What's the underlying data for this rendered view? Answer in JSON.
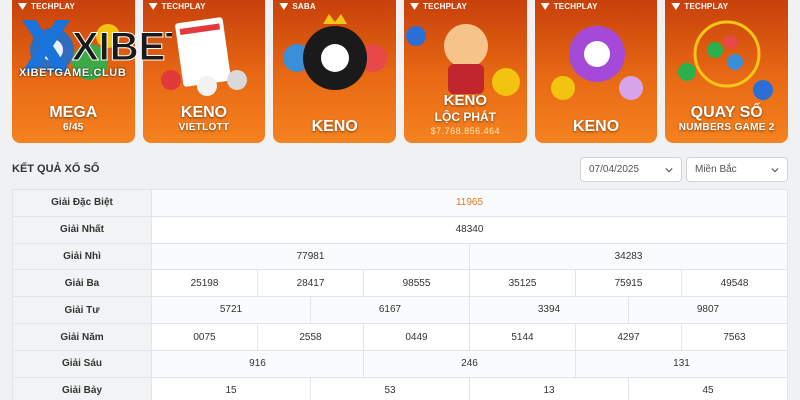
{
  "brand": {
    "name": "XIBET",
    "url": "XIBETGAME.CLUB"
  },
  "cards": [
    {
      "provider": "TECHPLAY",
      "title": "MEGA",
      "subtitle": "6/45"
    },
    {
      "provider": "TECHPLAY",
      "title": "KENO",
      "subtitle": "VIETLOTT"
    },
    {
      "provider": "SABA",
      "title": "KENO"
    },
    {
      "provider": "TECHPLAY",
      "title": "KENO",
      "subtitle": "LỘC PHÁT",
      "jackpot": "$7.768.856.464"
    },
    {
      "provider": "TECHPLAY",
      "title": "KENO"
    },
    {
      "provider": "TECHPLAY",
      "title": "QUAY SỐ",
      "subtitle": "NUMBERS GAME 2"
    }
  ],
  "results": {
    "title": "KẾT QUẢ XỔ SỐ",
    "date": "07/04/2025",
    "region": "Miền Bắc",
    "rows": [
      {
        "label": "Giải Đặc Biệt",
        "values": [
          "11965"
        ]
      },
      {
        "label": "Giải Nhất",
        "values": [
          "48340"
        ]
      },
      {
        "label": "Giải Nhì",
        "values": [
          "77981",
          "34283"
        ]
      },
      {
        "label": "Giải Ba",
        "values": [
          "25198",
          "28417",
          "98555",
          "35125",
          "75915",
          "49548"
        ]
      },
      {
        "label": "Giải Tư",
        "values": [
          "5721",
          "6167",
          "3394",
          "9807"
        ]
      },
      {
        "label": "Giải Năm",
        "values": [
          "0075",
          "2558",
          "0449",
          "5144",
          "4297",
          "7563"
        ]
      },
      {
        "label": "Giải Sáu",
        "values": [
          "916",
          "246",
          "131"
        ]
      },
      {
        "label": "Giải Bảy",
        "values": [
          "15",
          "53",
          "13",
          "45"
        ]
      }
    ]
  },
  "colors": {
    "card_orange": "#e86a14",
    "special_prize": "#e87722",
    "page_bg": "#f0f1f3"
  },
  "icons": [
    "techplay-logo-icon",
    "saba-logo-icon",
    "chevron-down-icon",
    "calendar-dropdown-icon"
  ]
}
